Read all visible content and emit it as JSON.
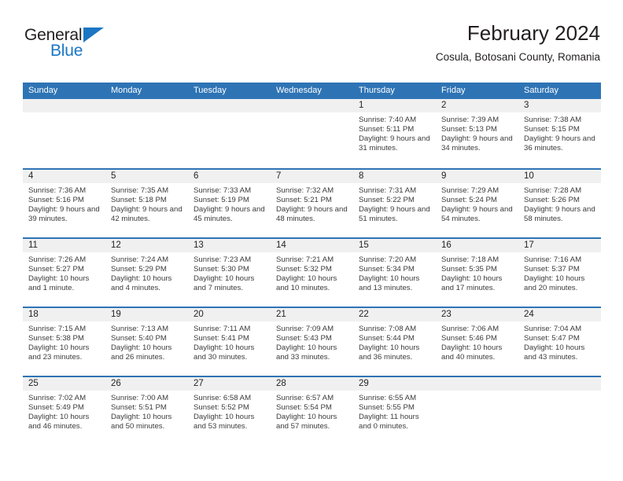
{
  "brand": {
    "name_top": "General",
    "name_bottom": "Blue",
    "triangle_color": "#1b77c4"
  },
  "header": {
    "title": "February 2024",
    "subtitle": "Cosula, Botosani County, Romania"
  },
  "theme": {
    "header_blue": "#2e74b5",
    "row_band": "#f0f0f0",
    "text": "#231f20"
  },
  "calendar": {
    "weekdays": [
      "Sunday",
      "Monday",
      "Tuesday",
      "Wednesday",
      "Thursday",
      "Friday",
      "Saturday"
    ],
    "weeks": [
      [
        {
          "day": "",
          "sunrise": "",
          "sunset": "",
          "daylight": ""
        },
        {
          "day": "",
          "sunrise": "",
          "sunset": "",
          "daylight": ""
        },
        {
          "day": "",
          "sunrise": "",
          "sunset": "",
          "daylight": ""
        },
        {
          "day": "",
          "sunrise": "",
          "sunset": "",
          "daylight": ""
        },
        {
          "day": "1",
          "sunrise": "Sunrise: 7:40 AM",
          "sunset": "Sunset: 5:11 PM",
          "daylight": "Daylight: 9 hours and 31 minutes."
        },
        {
          "day": "2",
          "sunrise": "Sunrise: 7:39 AM",
          "sunset": "Sunset: 5:13 PM",
          "daylight": "Daylight: 9 hours and 34 minutes."
        },
        {
          "day": "3",
          "sunrise": "Sunrise: 7:38 AM",
          "sunset": "Sunset: 5:15 PM",
          "daylight": "Daylight: 9 hours and 36 minutes."
        }
      ],
      [
        {
          "day": "4",
          "sunrise": "Sunrise: 7:36 AM",
          "sunset": "Sunset: 5:16 PM",
          "daylight": "Daylight: 9 hours and 39 minutes."
        },
        {
          "day": "5",
          "sunrise": "Sunrise: 7:35 AM",
          "sunset": "Sunset: 5:18 PM",
          "daylight": "Daylight: 9 hours and 42 minutes."
        },
        {
          "day": "6",
          "sunrise": "Sunrise: 7:33 AM",
          "sunset": "Sunset: 5:19 PM",
          "daylight": "Daylight: 9 hours and 45 minutes."
        },
        {
          "day": "7",
          "sunrise": "Sunrise: 7:32 AM",
          "sunset": "Sunset: 5:21 PM",
          "daylight": "Daylight: 9 hours and 48 minutes."
        },
        {
          "day": "8",
          "sunrise": "Sunrise: 7:31 AM",
          "sunset": "Sunset: 5:22 PM",
          "daylight": "Daylight: 9 hours and 51 minutes."
        },
        {
          "day": "9",
          "sunrise": "Sunrise: 7:29 AM",
          "sunset": "Sunset: 5:24 PM",
          "daylight": "Daylight: 9 hours and 54 minutes."
        },
        {
          "day": "10",
          "sunrise": "Sunrise: 7:28 AM",
          "sunset": "Sunset: 5:26 PM",
          "daylight": "Daylight: 9 hours and 58 minutes."
        }
      ],
      [
        {
          "day": "11",
          "sunrise": "Sunrise: 7:26 AM",
          "sunset": "Sunset: 5:27 PM",
          "daylight": "Daylight: 10 hours and 1 minute."
        },
        {
          "day": "12",
          "sunrise": "Sunrise: 7:24 AM",
          "sunset": "Sunset: 5:29 PM",
          "daylight": "Daylight: 10 hours and 4 minutes."
        },
        {
          "day": "13",
          "sunrise": "Sunrise: 7:23 AM",
          "sunset": "Sunset: 5:30 PM",
          "daylight": "Daylight: 10 hours and 7 minutes."
        },
        {
          "day": "14",
          "sunrise": "Sunrise: 7:21 AM",
          "sunset": "Sunset: 5:32 PM",
          "daylight": "Daylight: 10 hours and 10 minutes."
        },
        {
          "day": "15",
          "sunrise": "Sunrise: 7:20 AM",
          "sunset": "Sunset: 5:34 PM",
          "daylight": "Daylight: 10 hours and 13 minutes."
        },
        {
          "day": "16",
          "sunrise": "Sunrise: 7:18 AM",
          "sunset": "Sunset: 5:35 PM",
          "daylight": "Daylight: 10 hours and 17 minutes."
        },
        {
          "day": "17",
          "sunrise": "Sunrise: 7:16 AM",
          "sunset": "Sunset: 5:37 PM",
          "daylight": "Daylight: 10 hours and 20 minutes."
        }
      ],
      [
        {
          "day": "18",
          "sunrise": "Sunrise: 7:15 AM",
          "sunset": "Sunset: 5:38 PM",
          "daylight": "Daylight: 10 hours and 23 minutes."
        },
        {
          "day": "19",
          "sunrise": "Sunrise: 7:13 AM",
          "sunset": "Sunset: 5:40 PM",
          "daylight": "Daylight: 10 hours and 26 minutes."
        },
        {
          "day": "20",
          "sunrise": "Sunrise: 7:11 AM",
          "sunset": "Sunset: 5:41 PM",
          "daylight": "Daylight: 10 hours and 30 minutes."
        },
        {
          "day": "21",
          "sunrise": "Sunrise: 7:09 AM",
          "sunset": "Sunset: 5:43 PM",
          "daylight": "Daylight: 10 hours and 33 minutes."
        },
        {
          "day": "22",
          "sunrise": "Sunrise: 7:08 AM",
          "sunset": "Sunset: 5:44 PM",
          "daylight": "Daylight: 10 hours and 36 minutes."
        },
        {
          "day": "23",
          "sunrise": "Sunrise: 7:06 AM",
          "sunset": "Sunset: 5:46 PM",
          "daylight": "Daylight: 10 hours and 40 minutes."
        },
        {
          "day": "24",
          "sunrise": "Sunrise: 7:04 AM",
          "sunset": "Sunset: 5:47 PM",
          "daylight": "Daylight: 10 hours and 43 minutes."
        }
      ],
      [
        {
          "day": "25",
          "sunrise": "Sunrise: 7:02 AM",
          "sunset": "Sunset: 5:49 PM",
          "daylight": "Daylight: 10 hours and 46 minutes."
        },
        {
          "day": "26",
          "sunrise": "Sunrise: 7:00 AM",
          "sunset": "Sunset: 5:51 PM",
          "daylight": "Daylight: 10 hours and 50 minutes."
        },
        {
          "day": "27",
          "sunrise": "Sunrise: 6:58 AM",
          "sunset": "Sunset: 5:52 PM",
          "daylight": "Daylight: 10 hours and 53 minutes."
        },
        {
          "day": "28",
          "sunrise": "Sunrise: 6:57 AM",
          "sunset": "Sunset: 5:54 PM",
          "daylight": "Daylight: 10 hours and 57 minutes."
        },
        {
          "day": "29",
          "sunrise": "Sunrise: 6:55 AM",
          "sunset": "Sunset: 5:55 PM",
          "daylight": "Daylight: 11 hours and 0 minutes."
        },
        {
          "day": "",
          "sunrise": "",
          "sunset": "",
          "daylight": ""
        },
        {
          "day": "",
          "sunrise": "",
          "sunset": "",
          "daylight": ""
        }
      ]
    ]
  }
}
